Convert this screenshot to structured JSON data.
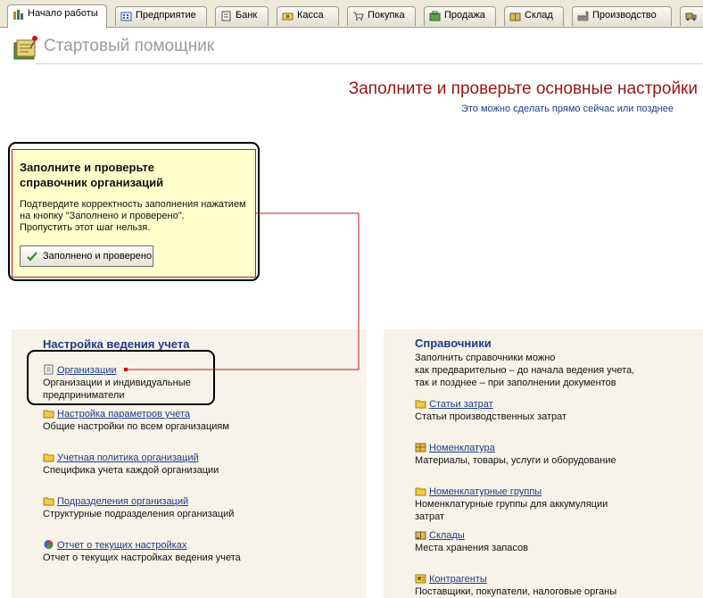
{
  "tabs": [
    {
      "label": "Начало работы",
      "icon": "start-icon",
      "active": true
    },
    {
      "label": "Предприятие",
      "icon": "enterprise-icon"
    },
    {
      "label": "Банк",
      "icon": "bank-icon"
    },
    {
      "label": "Касса",
      "icon": "cash-icon"
    },
    {
      "label": "Покупка",
      "icon": "purchase-icon"
    },
    {
      "label": "Продажа",
      "icon": "sale-icon"
    },
    {
      "label": "Склад",
      "icon": "warehouse-icon"
    },
    {
      "label": "Производство",
      "icon": "production-icon"
    }
  ],
  "header": {
    "title": "Стартовый помощник"
  },
  "main": {
    "title": "Заполните и проверьте основные настройки",
    "subtitle_link": "Это можно сделать прямо сейчас или позднее"
  },
  "hint": {
    "title_line1": "Заполните и проверьте",
    "title_line2": "справочник организаций",
    "text_line1": "Подтвердите корректность заполнения нажатием",
    "text_line2": "на кнопку \"Заполнено и проверено\".",
    "text_line3": "Пропустить этот шаг нельзя.",
    "button_label": "Заполнено и проверено"
  },
  "left_section": {
    "title": "Настройка ведения учета",
    "items": [
      {
        "link": "Организации",
        "desc1": "Организации и индивидуальные",
        "desc2": "предприниматели",
        "icon": "document-icon"
      },
      {
        "link": "Настройка параметров учета",
        "desc1": "Общие настройки по всем организациям",
        "icon": "folder-icon"
      },
      {
        "link": "Учетная политика организаций",
        "desc1": "Специфика учета каждой организации",
        "icon": "folder-icon"
      },
      {
        "link": "Подразделения организаций",
        "desc1": "Структурные подразделения организаций",
        "icon": "folder-icon"
      },
      {
        "link": "Отчет о текущих настройках",
        "desc1": "Отчет о текущих настройках ведения учета",
        "icon": "report-icon"
      }
    ]
  },
  "right_section": {
    "title": "Справочники",
    "intro1": "Заполнить справочники можно",
    "intro2": "как предварительно – до начала ведения учета,",
    "intro3": "так и позднее – при заполнении документов",
    "items": [
      {
        "link": "Статьи затрат",
        "desc1": "Статьи производственных затрат",
        "icon": "folder-icon"
      },
      {
        "link": "Номенклатура",
        "desc1": "Материалы, товары, услуги и оборудование",
        "icon": "nomenclature-icon"
      },
      {
        "link": "Номенклатурные группы",
        "desc1": "Номенклатурные группы для аккумуляции",
        "desc2": "затрат",
        "icon": "folder-icon"
      },
      {
        "link": "Склады",
        "desc1": "Места хранения запасов",
        "icon": "warehouse-icon"
      },
      {
        "link": "Контрагенты",
        "desc1": "Поставщики, покупатели, налоговые органы",
        "icon": "contractors-icon"
      }
    ]
  }
}
